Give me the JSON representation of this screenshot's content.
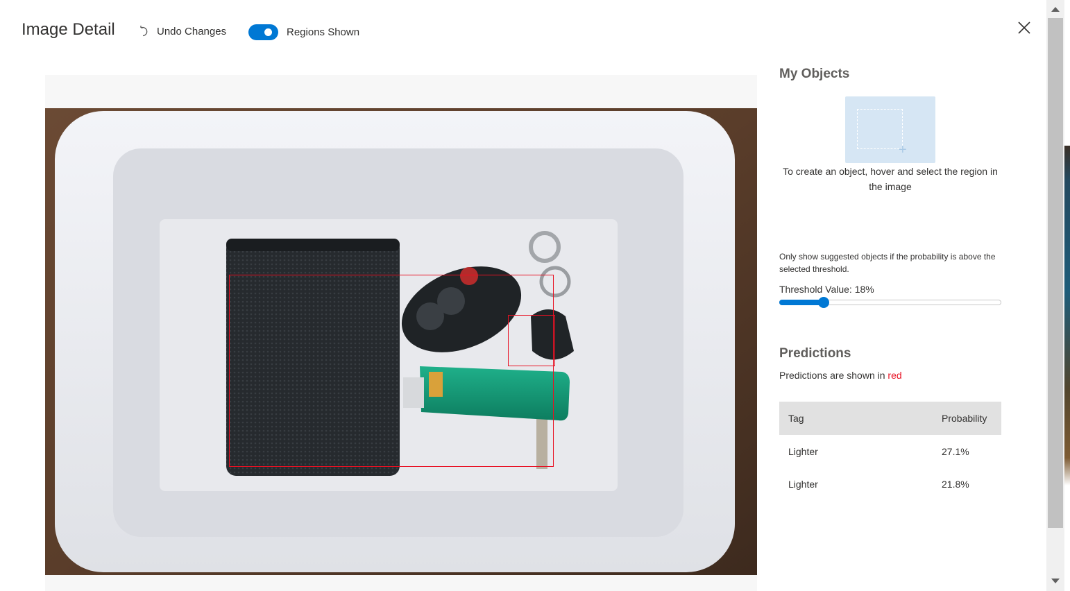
{
  "header": {
    "title": "Image Detail",
    "undo_label": "Undo Changes",
    "regions_toggle_label": "Regions Shown",
    "regions_toggle_on": true
  },
  "my_objects": {
    "title": "My Objects",
    "hint": "To create an object, hover and select the region in the image"
  },
  "threshold": {
    "hint": "Only show suggested objects if the probability is above the selected threshold.",
    "label": "Threshold Value: 18%",
    "value_percent": 18
  },
  "predictions": {
    "title": "Predictions",
    "note_prefix": "Predictions are shown in ",
    "note_color_word": "red",
    "columns": {
      "tag": "Tag",
      "probability": "Probability"
    },
    "rows": [
      {
        "tag": "Lighter",
        "probability": "27.1%"
      },
      {
        "tag": "Lighter",
        "probability": "21.8%"
      }
    ]
  },
  "colors": {
    "accent": "#0078d4",
    "prediction_box": "#e81123"
  },
  "icons": [
    "undo-icon",
    "close-icon",
    "add-region-icon"
  ]
}
